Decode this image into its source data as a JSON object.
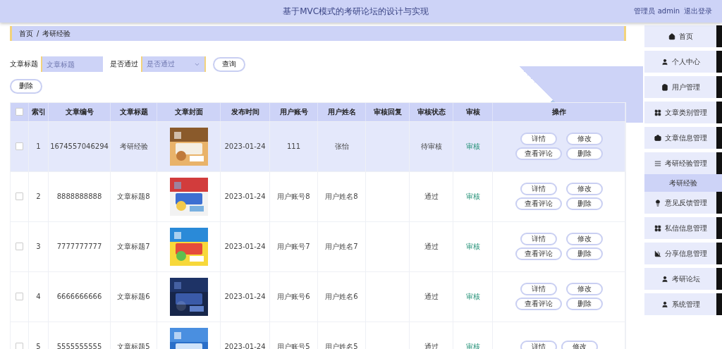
{
  "header": {
    "title": "基于MVC模式的考研论坛的设计与实现",
    "user": "管理员 admin",
    "logout": "退出登录"
  },
  "breadcrumb": [
    "首页",
    "/",
    "考研经验"
  ],
  "search": {
    "fields": [
      {
        "label": "文章标题",
        "kind": "input",
        "placeholder": "文章标题"
      },
      {
        "label": "是否通过",
        "kind": "select",
        "placeholder": "是否通过"
      }
    ],
    "button": "查询"
  },
  "delete_button": "删除",
  "table": {
    "columns": [
      "索引",
      "文章编号",
      "文章标题",
      "文章封面",
      "发布时间",
      "用户账号",
      "用户姓名",
      "审核回复",
      "审核状态",
      "审核",
      "操作"
    ],
    "header_checked": false,
    "rows": [
      {
        "selected": true,
        "checked": false,
        "index": "1",
        "id": "1674557046294",
        "title": "考研经验",
        "date": "2023-01-24",
        "account": "111",
        "name": "张怡",
        "reply": "",
        "status": "待审核",
        "review": "审核",
        "actions": [
          "详情",
          "修改",
          "查看评论",
          "删除"
        ]
      },
      {
        "selected": false,
        "checked": false,
        "index": "2",
        "id": "8888888888",
        "title": "文章标题8",
        "date": "2023-01-24",
        "account": "用户账号8",
        "name": "用户姓名8",
        "reply": "",
        "status": "通过",
        "review": "审核",
        "actions": [
          "详情",
          "修改",
          "查看评论",
          "删除"
        ]
      },
      {
        "selected": false,
        "checked": false,
        "index": "3",
        "id": "7777777777",
        "title": "文章标题7",
        "date": "2023-01-24",
        "account": "用户账号7",
        "name": "用户姓名7",
        "reply": "",
        "status": "通过",
        "review": "审核",
        "actions": [
          "详情",
          "修改",
          "查看评论",
          "删除"
        ]
      },
      {
        "selected": false,
        "checked": false,
        "index": "4",
        "id": "6666666666",
        "title": "文章标题6",
        "date": "2023-01-24",
        "account": "用户账号6",
        "name": "用户姓名6",
        "reply": "",
        "status": "通过",
        "review": "审核",
        "actions": [
          "详情",
          "修改",
          "查看评论",
          "删除"
        ]
      },
      {
        "selected": false,
        "checked": false,
        "index": "5",
        "id": "5555555555",
        "title": "文章标题5",
        "date": "2023-01-24",
        "account": "用户账号5",
        "name": "用户姓名5",
        "reply": "",
        "status": "通过",
        "review": "审核",
        "actions": [
          "详情",
          "修改"
        ]
      }
    ]
  },
  "sidebar": {
    "items": [
      {
        "label": "首页",
        "kind": "menu",
        "selected": false
      },
      {
        "label": "个人中心",
        "kind": "menu",
        "selected": false
      },
      {
        "label": "用户管理",
        "kind": "menu",
        "selected": false
      },
      {
        "label": "文章类别管理",
        "kind": "menu",
        "selected": false
      },
      {
        "label": "文章信息管理",
        "kind": "menu",
        "selected": false
      },
      {
        "label": "考研经验管理",
        "kind": "menu",
        "selected": false
      },
      {
        "label": "考研经验",
        "kind": "sub",
        "selected": true
      },
      {
        "label": "意见反馈管理",
        "kind": "menu",
        "selected": false
      },
      {
        "label": "私信信息管理",
        "kind": "menu",
        "selected": false
      },
      {
        "label": "分享信息管理",
        "kind": "menu",
        "selected": false
      },
      {
        "label": "考研论坛",
        "kind": "menu",
        "selected": false
      },
      {
        "label": "系统管理",
        "kind": "menu",
        "selected": false
      }
    ]
  }
}
